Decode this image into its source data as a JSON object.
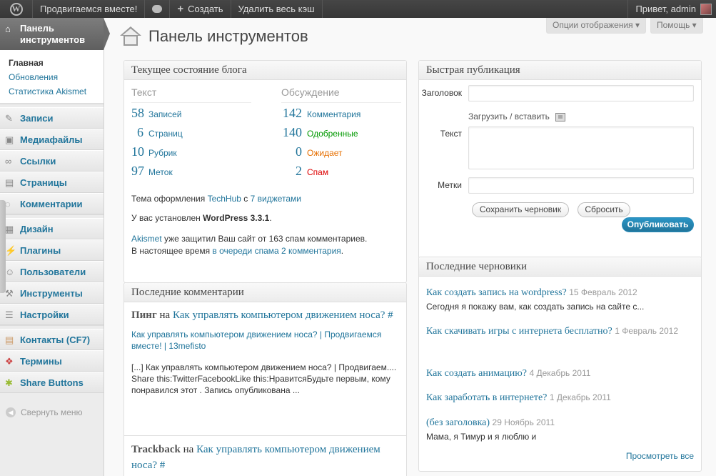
{
  "adminbar": {
    "site": "Продвигаемся вместе!",
    "create": "Создать",
    "clear_cache": "Удалить весь кэш",
    "greeting": "Привет, admin"
  },
  "sidebar": {
    "current": "Панель инструментов",
    "submenu": [
      "Главная",
      "Обновления",
      "Статистика Akismet"
    ],
    "items": [
      {
        "label": "Записи",
        "icon": "pin-icon"
      },
      {
        "label": "Медиафайлы",
        "icon": "media-icon"
      },
      {
        "label": "Ссылки",
        "icon": "link-icon"
      },
      {
        "label": "Страницы",
        "icon": "pages-icon"
      },
      {
        "label": "Комментарии",
        "icon": "comments-icon"
      },
      {
        "label": "Дизайн",
        "icon": "appearance-icon"
      },
      {
        "label": "Плагины",
        "icon": "plugins-icon"
      },
      {
        "label": "Пользователи",
        "icon": "users-icon"
      },
      {
        "label": "Инструменты",
        "icon": "tools-icon"
      },
      {
        "label": "Настройки",
        "icon": "settings-icon"
      },
      {
        "label": "Контакты (CF7)",
        "icon": "contact-form-icon"
      },
      {
        "label": "Термины",
        "icon": "terms-icon"
      },
      {
        "label": "Share Buttons",
        "icon": "share-icon"
      }
    ],
    "collapse": "Свернуть меню"
  },
  "header": {
    "title": "Панель инструментов",
    "screen_options": "Опции отображения ▾",
    "help": "Помощь ▾"
  },
  "right_now": {
    "title": "Текущее состояние блога",
    "content_head": "Текст",
    "discussion_head": "Обсуждение",
    "content": [
      {
        "num": "58",
        "label": "Записей"
      },
      {
        "num": "6",
        "label": "Страниц"
      },
      {
        "num": "10",
        "label": "Рубрик"
      },
      {
        "num": "97",
        "label": "Меток"
      }
    ],
    "discussion": [
      {
        "num": "142",
        "label": "Комментария"
      },
      {
        "num": "140",
        "label": "Одобренные"
      },
      {
        "num": "0",
        "label": "Ожидает"
      },
      {
        "num": "2",
        "label": "Спам"
      }
    ],
    "theme_prefix": "Тема оформления ",
    "theme_name": "TechHub",
    "theme_mid": " с ",
    "widgets": "7 виджетами",
    "version_prefix": "У вас установлен ",
    "version": "WordPress 3.3.1",
    "version_suffix": ".",
    "akismet": "Akismet",
    "akismet_text": " уже защитил Ваш сайт от 163 спам комментариев.",
    "queue_prefix": "В настоящее время ",
    "queue_link": "в очереди спама 2 комментария",
    "queue_suffix": "."
  },
  "recent_comments": {
    "title": "Последние комментарии",
    "items": [
      {
        "type": "Пинг",
        "on": " на ",
        "post": "Как управлять компьютером движением носа? #",
        "author": "Как управлять компьютером движением носа? | Продвигаемся вместе! | 13mefisto",
        "excerpt": "[...] Как управлять компьютером движением носа? | Продвигаем.... Share this:TwitterFacebookLike this:НравитсяБудьте первым, кому понравился этот . Запись опубликована ..."
      },
      {
        "type": "Trackback",
        "on": " на ",
        "post": "Как управлять компьютером движением носа? #"
      }
    ]
  },
  "quick_press": {
    "title": "Быстрая публикация",
    "title_label": "Заголовок",
    "upload": "Загрузить / вставить",
    "text_label": "Текст",
    "tags_label": "Метки",
    "save_draft": "Сохранить черновик",
    "reset": "Сбросить",
    "publish": "Опубликовать"
  },
  "recent_drafts": {
    "title": "Последние черновики",
    "items": [
      {
        "title": "Как создать запись на wordpress?",
        "date": "15 Февраль 2012",
        "excerpt": "Сегодня я покажу вам, как создать запись на сайте с..."
      },
      {
        "title": "Как скачивать игры с интернета бесплатно?",
        "date": "1 Февраль 2012"
      },
      {
        "title": "Как создать анимацию?",
        "date": "4 Декабрь 2011"
      },
      {
        "title": "Как заработать в интернете?",
        "date": "1 Декабрь 2011"
      },
      {
        "title": "(без заголовка)",
        "date": "29 Ноябрь 2011",
        "excerpt": "Мама, я Тимур и я люблю и"
      }
    ],
    "view_all": "Просмотреть все"
  }
}
